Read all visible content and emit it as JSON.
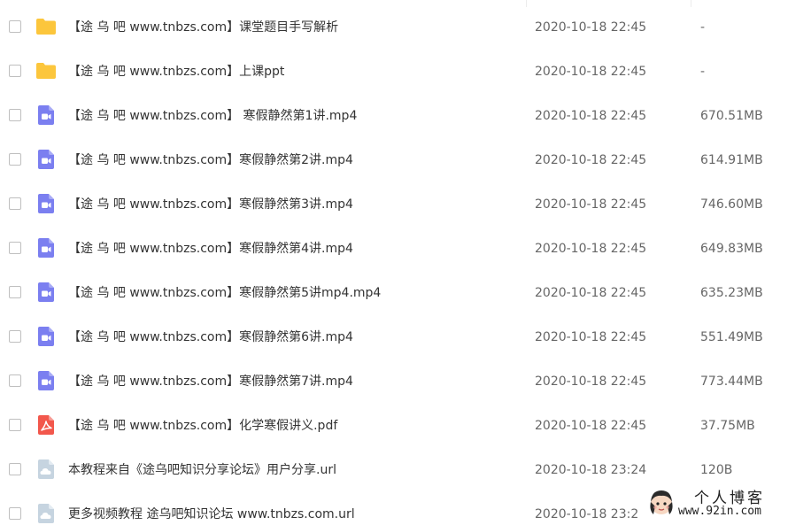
{
  "files": [
    {
      "type": "folder",
      "icon": "folder-icon",
      "name": "【途 乌 吧 www.tnbzs.com】课堂题目手写解析",
      "date": "2020-10-18 22:45",
      "size": "-"
    },
    {
      "type": "folder",
      "icon": "folder-icon",
      "name": "【途 乌 吧 www.tnbzs.com】上课ppt",
      "date": "2020-10-18 22:45",
      "size": "-"
    },
    {
      "type": "video",
      "icon": "video-file-icon",
      "name": "【途 乌 吧 www.tnbzs.com】 寒假静然第1讲.mp4",
      "date": "2020-10-18 22:45",
      "size": "670.51MB"
    },
    {
      "type": "video",
      "icon": "video-file-icon",
      "name": "【途 乌 吧 www.tnbzs.com】寒假静然第2讲.mp4",
      "date": "2020-10-18 22:45",
      "size": "614.91MB"
    },
    {
      "type": "video",
      "icon": "video-file-icon",
      "name": "【途 乌 吧 www.tnbzs.com】寒假静然第3讲.mp4",
      "date": "2020-10-18 22:45",
      "size": "746.60MB"
    },
    {
      "type": "video",
      "icon": "video-file-icon",
      "name": "【途 乌 吧 www.tnbzs.com】寒假静然第4讲.mp4",
      "date": "2020-10-18 22:45",
      "size": "649.83MB"
    },
    {
      "type": "video",
      "icon": "video-file-icon",
      "name": "【途 乌 吧 www.tnbzs.com】寒假静然第5讲mp4.mp4",
      "date": "2020-10-18 22:45",
      "size": "635.23MB"
    },
    {
      "type": "video",
      "icon": "video-file-icon",
      "name": "【途 乌 吧 www.tnbzs.com】寒假静然第6讲.mp4",
      "date": "2020-10-18 22:45",
      "size": "551.49MB"
    },
    {
      "type": "video",
      "icon": "video-file-icon",
      "name": "【途 乌 吧 www.tnbzs.com】寒假静然第7讲.mp4",
      "date": "2020-10-18 22:45",
      "size": "773.44MB"
    },
    {
      "type": "pdf",
      "icon": "pdf-file-icon",
      "name": "【途 乌 吧 www.tnbzs.com】化学寒假讲义.pdf",
      "date": "2020-10-18 22:45",
      "size": "37.75MB"
    },
    {
      "type": "url",
      "icon": "url-file-icon",
      "name": "本教程来自《途乌吧知识分享论坛》用户分享.url",
      "date": "2020-10-18 23:24",
      "size": "120B"
    },
    {
      "type": "url",
      "icon": "url-file-icon",
      "name": "更多视频教程 途乌吧知识论坛 www.tnbzs.com.url",
      "date": "2020-10-18 23:2",
      "size": ""
    }
  ],
  "colors": {
    "folder": "#fcc63c",
    "video": "#7b7ff0",
    "pdf": "#f2574c",
    "url": "#c6d4e0"
  },
  "watermark": {
    "title": "个人博客",
    "url": "www.92in.com"
  }
}
